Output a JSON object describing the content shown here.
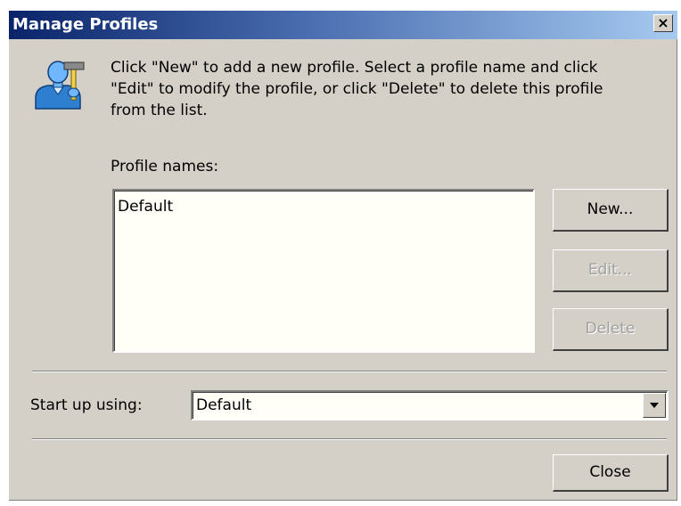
{
  "window": {
    "title": "Manage Profiles",
    "close_glyph": "×"
  },
  "icon": "profile-manager-icon",
  "description": "Click \"New\" to add a new profile.  Select a profile name and click\n\"Edit\" to modify the profile, or click \"Delete\" to delete this profile\nfrom the list.",
  "profiles": {
    "label": "Profile names:",
    "items": [
      "Default"
    ]
  },
  "buttons": {
    "new_label": "New...",
    "edit_label": "Edit...",
    "delete_label": "Delete",
    "close_label": "Close"
  },
  "startup": {
    "label": "Start up using:",
    "selected": "Default"
  },
  "colors": {
    "dialog_bg": "#d4d0c8",
    "title_start": "#0a246a",
    "title_end": "#a6caf0",
    "disabled_text": "#a0a0a0"
  }
}
